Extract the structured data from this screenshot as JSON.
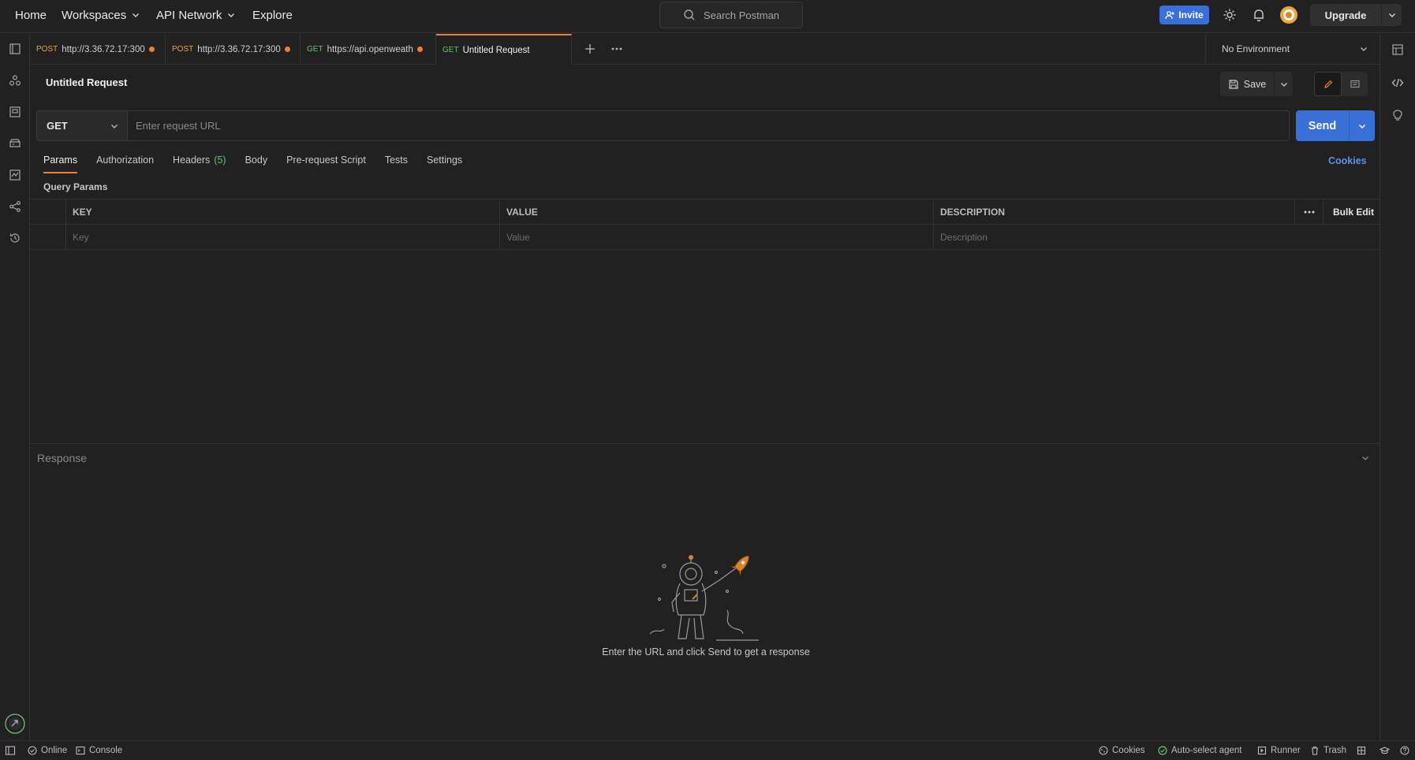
{
  "topnav": {
    "home": "Home",
    "workspaces": "Workspaces",
    "api_network": "API Network",
    "explore": "Explore",
    "search_placeholder": "Search Postman",
    "invite": "Invite",
    "upgrade": "Upgrade"
  },
  "tabs": [
    {
      "method": "POST",
      "url": "http://3.36.72.17:300",
      "unsaved": true
    },
    {
      "method": "POST",
      "url": "http://3.36.72.17:300",
      "unsaved": true
    },
    {
      "method": "GET",
      "url": "https://api.openweath",
      "unsaved": true
    },
    {
      "method": "GET",
      "url": "Untitled Request",
      "unsaved": false,
      "active": true
    }
  ],
  "environment": "No Environment",
  "request": {
    "title": "Untitled Request",
    "save_label": "Save",
    "method": "GET",
    "url_placeholder": "Enter request URL",
    "send_label": "Send"
  },
  "request_tabs": {
    "params": "Params",
    "authorization": "Authorization",
    "headers": "Headers",
    "headers_count": "(5)",
    "body": "Body",
    "pre_request": "Pre-request Script",
    "tests": "Tests",
    "settings": "Settings",
    "cookies": "Cookies"
  },
  "query_params": {
    "label": "Query Params",
    "col_key": "KEY",
    "col_value": "VALUE",
    "col_description": "DESCRIPTION",
    "bulk_edit": "Bulk Edit",
    "key_placeholder": "Key",
    "value_placeholder": "Value",
    "description_placeholder": "Description"
  },
  "response": {
    "label": "Response",
    "empty_message": "Enter the URL and click Send to get a response"
  },
  "statusbar": {
    "online": "Online",
    "console": "Console",
    "cookies": "Cookies",
    "auto_select_agent": "Auto-select agent",
    "runner": "Runner",
    "trash": "Trash"
  },
  "colors": {
    "accent": "#f07c38",
    "primary": "#3b6fd8",
    "post_method": "#f5a623",
    "get_method": "#6cc070",
    "link": "#5c93e8"
  }
}
